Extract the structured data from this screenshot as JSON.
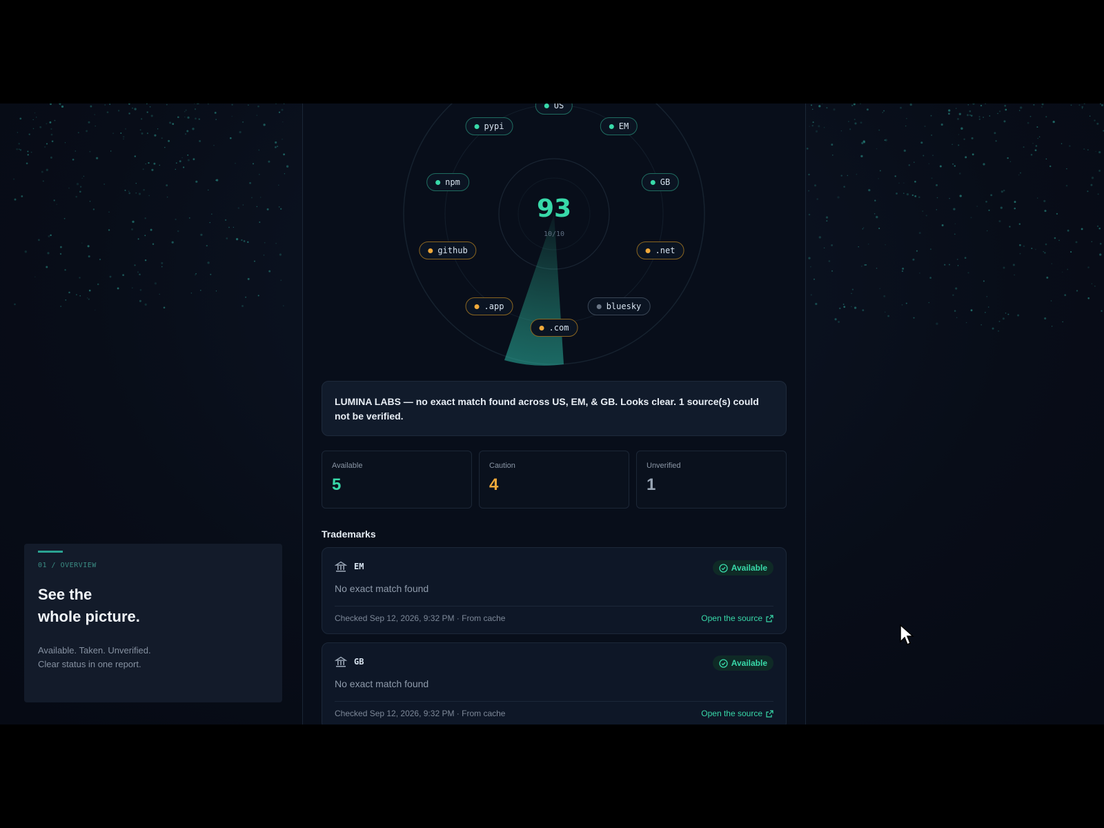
{
  "radar": {
    "score": "93",
    "sub": "10/10",
    "chips": [
      {
        "label": "US",
        "status": "ok"
      },
      {
        "label": "pypi",
        "status": "ok"
      },
      {
        "label": "EM",
        "status": "ok"
      },
      {
        "label": "npm",
        "status": "ok"
      },
      {
        "label": "GB",
        "status": "ok"
      },
      {
        "label": "github",
        "status": "warn"
      },
      {
        "label": ".net",
        "status": "warn"
      },
      {
        "label": ".app",
        "status": "warn"
      },
      {
        "label": "bluesky",
        "status": "unk"
      },
      {
        "label": ".com",
        "status": "warn"
      }
    ]
  },
  "summary": {
    "text": "LUMINA LABS — no exact match found across US, EM, & GB. Looks clear. 1 source(s) could not be verified."
  },
  "stats": [
    {
      "label": "Available",
      "value": "5",
      "color": "#38d9a9"
    },
    {
      "label": "Caution",
      "value": "4",
      "color": "#f0a93a"
    },
    {
      "label": "Unverified",
      "value": "1",
      "color": "#9aa6b5"
    }
  ],
  "trademarks": {
    "title": "Trademarks",
    "items": [
      {
        "code": "EM",
        "status": "Available",
        "description": "No exact match found",
        "checked": "Checked Sep 12, 2026, 9:32 PM · From cache",
        "link": "Open the source"
      },
      {
        "code": "GB",
        "status": "Available",
        "description": "No exact match found",
        "checked": "Checked Sep 12, 2026, 9:32 PM · From cache",
        "link": "Open the source"
      }
    ]
  },
  "overview": {
    "kicker": "01 / OVERVIEW",
    "title_line1": "See the",
    "title_line2": "whole picture.",
    "body_line1": "Available. Taken. Unverified.",
    "body_line2": "Clear status in one report."
  },
  "colors": {
    "accent": "#38d9a9",
    "caution": "#f0a93a",
    "background": "#080e1a"
  }
}
